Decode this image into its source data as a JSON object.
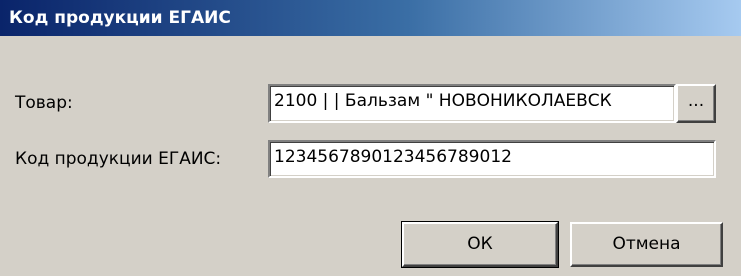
{
  "window": {
    "title": "Код продукции ЕГАИС"
  },
  "form": {
    "product_label": "Товар:",
    "product_value": "2100 |  | Бальзам \" НОВОНИКОЛАЕВСК",
    "browse_label": "...",
    "code_label": "Код продукции ЕГАИС:",
    "code_value": "1234567890123456789012"
  },
  "buttons": {
    "ok_label": "ОК",
    "cancel_label": "Отмена"
  }
}
